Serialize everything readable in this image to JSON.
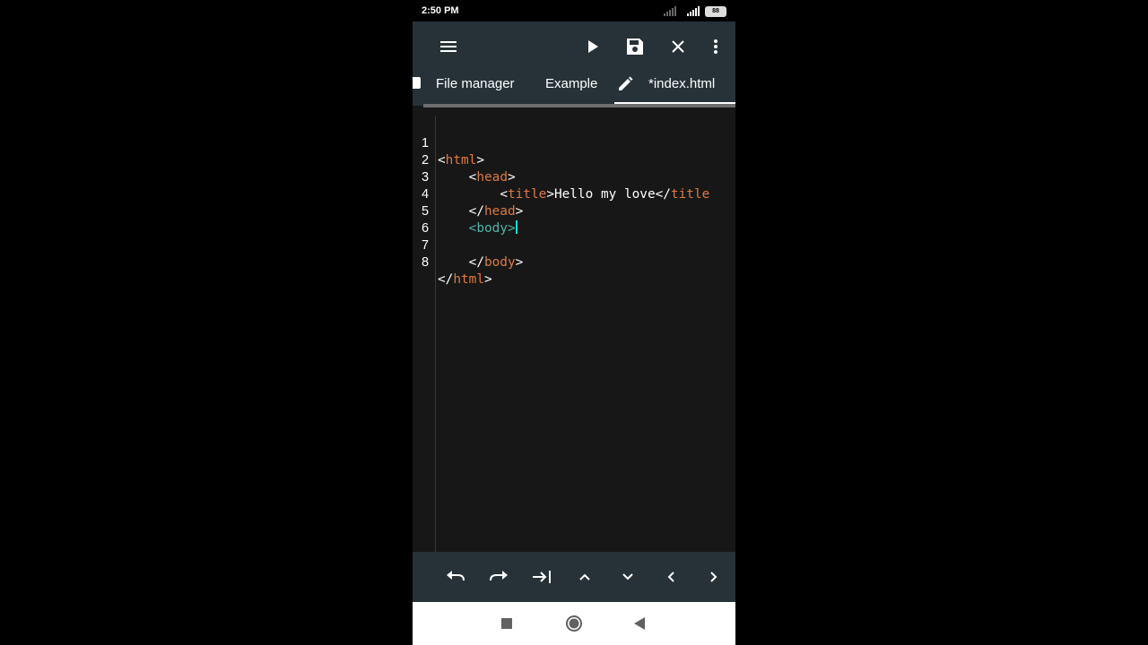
{
  "status": {
    "time": "2:50 PM",
    "battery": "88"
  },
  "toolbar": {
    "menu_icon": "hamburger-menu-icon",
    "run_icon": "play-icon",
    "save_icon": "save-icon",
    "close_icon": "close-icon",
    "more_icon": "more-vert-icon"
  },
  "tabs": [
    {
      "label": "File manager"
    },
    {
      "label": "Example"
    },
    {
      "label": "*index.html",
      "icon": "pencil-icon",
      "active": true
    }
  ],
  "editor": {
    "line_numbers": [
      "1",
      "2",
      "3",
      "4",
      "5",
      "6",
      "7",
      "8"
    ],
    "lines": [
      {
        "indent": "",
        "open": "<",
        "tag": "html",
        "close": ">",
        "text": ""
      },
      {
        "indent": "    ",
        "open": "<",
        "tag": "head",
        "close": ">",
        "text": ""
      },
      {
        "indent": "        ",
        "open": "<",
        "tag": "title",
        "close": ">",
        "text": "Hello my love",
        "end_open": "</",
        "end_tag": "title"
      },
      {
        "indent": "    ",
        "open": "</",
        "tag": "head",
        "close": ">",
        "text": ""
      },
      {
        "indent": "    ",
        "open": "<",
        "tag": "body",
        "close": ">",
        "text": ""
      },
      {
        "indent": "",
        "open": "",
        "tag": "",
        "close": "",
        "text": ""
      },
      {
        "indent": "    ",
        "open": "</",
        "tag": "body",
        "close": ">",
        "text": ""
      },
      {
        "indent": "",
        "open": "</",
        "tag": "html",
        "close": ">",
        "text": ""
      }
    ]
  },
  "bottom_toolbar": [
    "undo-icon",
    "redo-icon",
    "tab-indent-icon",
    "arrow-up-icon",
    "arrow-down-icon",
    "arrow-left-icon",
    "arrow-right-icon"
  ],
  "nav": [
    "recents-square-icon",
    "home-circle-icon",
    "back-triangle-icon"
  ],
  "colors": {
    "appbar": "#263238",
    "editor_bg": "#171717",
    "tag": "#e0793f",
    "selected_tag": "#4db6ac"
  }
}
